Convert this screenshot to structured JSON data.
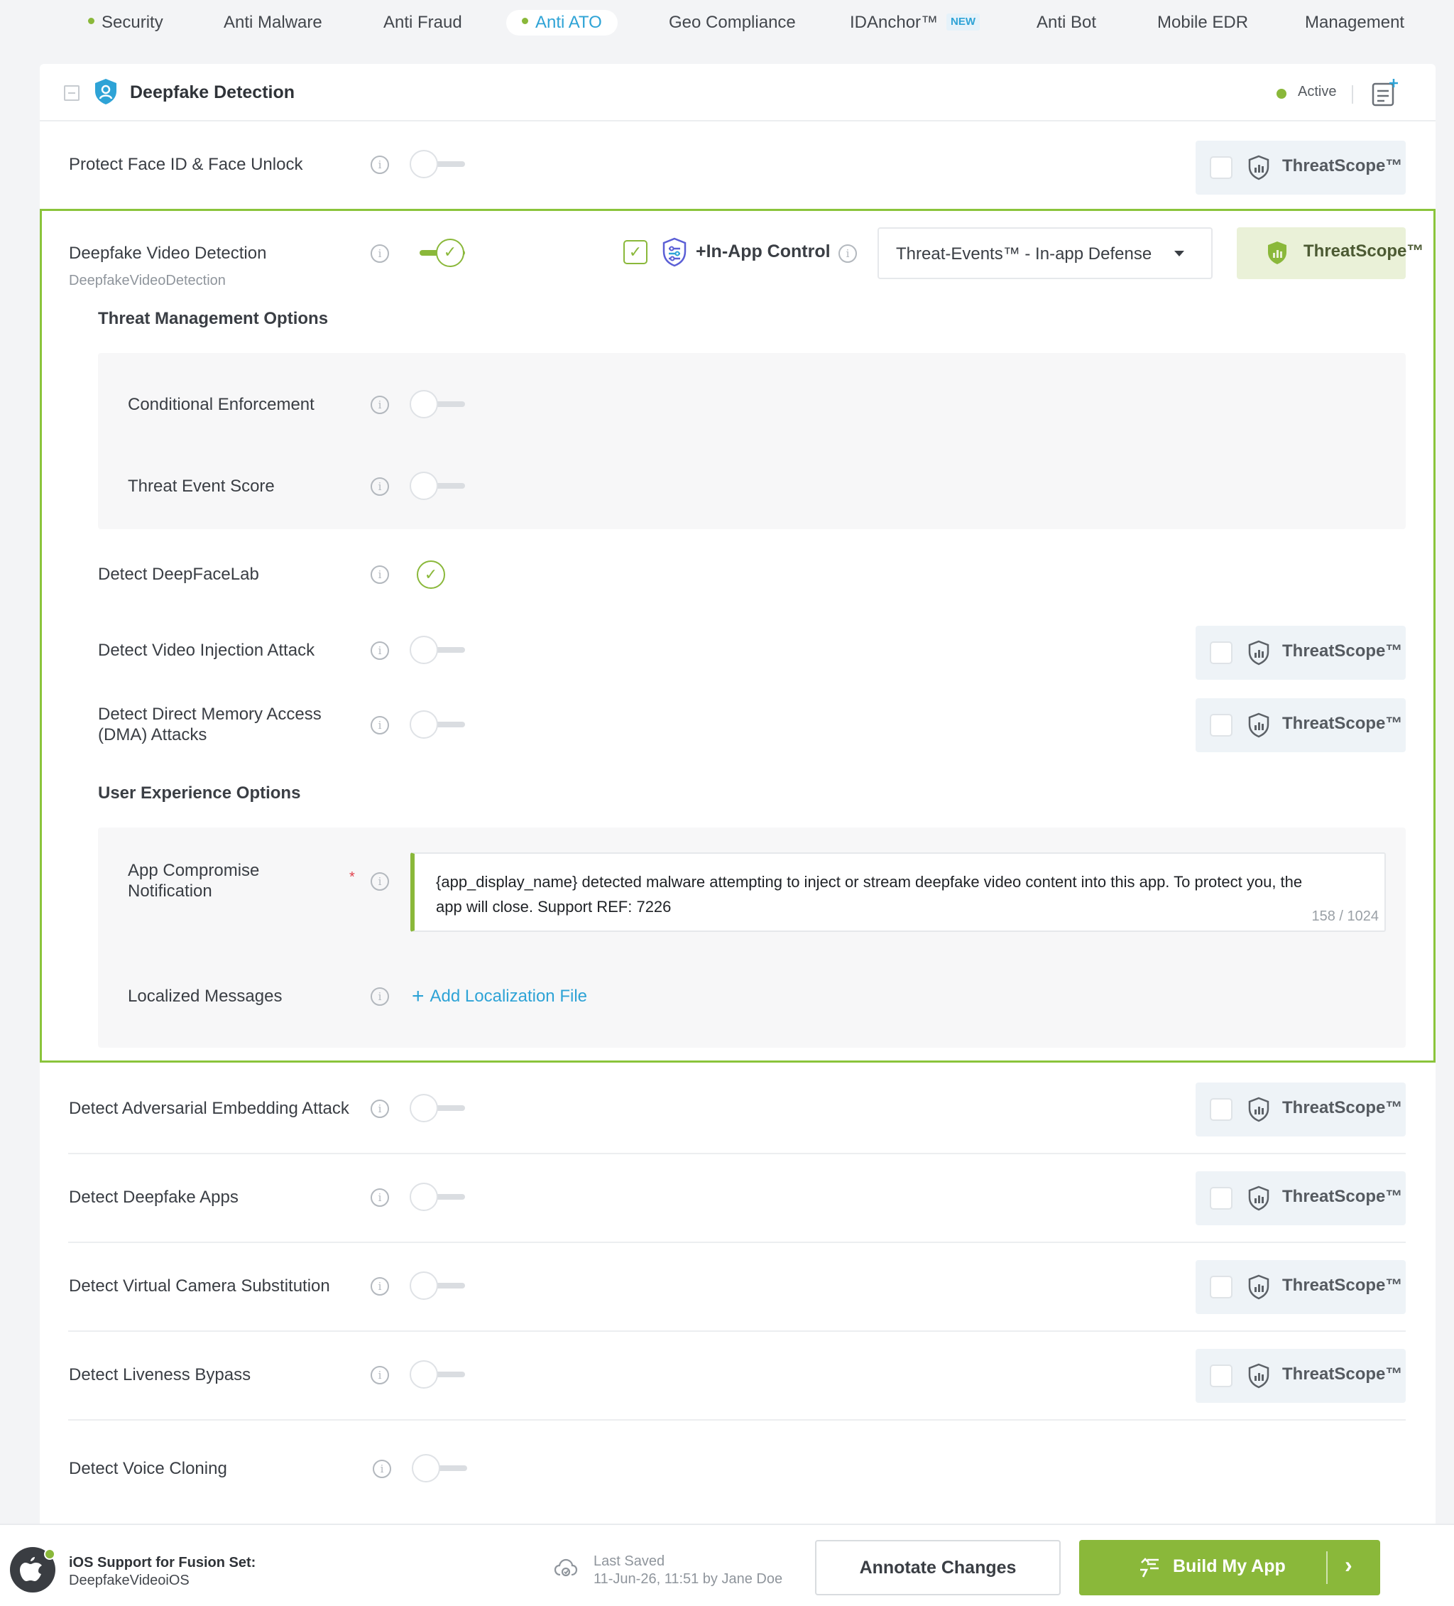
{
  "tabs": [
    {
      "label": "Security",
      "dot": true
    },
    {
      "label": "Anti Malware"
    },
    {
      "label": "Anti Fraud"
    },
    {
      "label": "Anti ATO",
      "dot": true,
      "active": true
    },
    {
      "label": "Geo Compliance"
    },
    {
      "label": "IDAnchor™",
      "badge": "NEW"
    },
    {
      "label": "Anti Bot"
    },
    {
      "label": "Mobile EDR"
    },
    {
      "label": "Management"
    }
  ],
  "section": {
    "title": "Deepfake Detection",
    "status": "Active"
  },
  "threatscope_label": "ThreatScope™",
  "rows": {
    "protect_face": {
      "label": "Protect Face ID & Face Unlock",
      "enabled": false
    },
    "video": {
      "label": "Deepfake Video Detection",
      "id": "DeepfakeVideoDetection",
      "enabled": true,
      "inapp_label": "+In-App Control",
      "inapp_checked": true,
      "select_value": "Threat-Events™ - In-app Defense"
    },
    "threat_mgmt_heading": "Threat Management Options",
    "conditional": {
      "label": "Conditional Enforcement",
      "enabled": false
    },
    "score": {
      "label": "Threat Event Score",
      "enabled": false
    },
    "deepfacelab": {
      "label": "Detect DeepFaceLab",
      "checked": true
    },
    "injection": {
      "label": "Detect Video Injection Attack",
      "enabled": false
    },
    "dma": {
      "label_line1": "Detect Direct Memory Access",
      "label_line2": "(DMA) Attacks",
      "enabled": false
    },
    "ux_heading": "User Experience Options",
    "notification": {
      "label_line1": "App Compromise",
      "label_line2": "Notification",
      "required_mark": "*",
      "message": "{app_display_name} detected malware attempting to inject or stream deepfake video content into this app. To protect you, the app will close. Support REF: 7226",
      "count": "158 / 1024"
    },
    "localized": {
      "label": "Localized Messages",
      "link": "Add Localization File"
    },
    "adversarial": {
      "label": "Detect Adversarial Embedding Attack",
      "enabled": false
    },
    "apps": {
      "label": "Detect Deepfake Apps",
      "enabled": false
    },
    "camera": {
      "label": "Detect Virtual Camera Substitution",
      "enabled": false
    },
    "liveness": {
      "label": "Detect Liveness Bypass",
      "enabled": false
    },
    "voice": {
      "label": "Detect Voice Cloning",
      "enabled": false
    }
  },
  "footer": {
    "platform_title": "iOS Support for Fusion Set:",
    "platform_name": "DeepfakeVideoiOS",
    "last_saved_label": "Last Saved",
    "last_saved_value": "11-Jun-26, 11:51 by Jane Doe",
    "annotate_label": "Annotate Changes",
    "build_label": "Build My App"
  },
  "colors": {
    "accent_green": "#8ab83a",
    "accent_blue": "#2ea3d6",
    "frame_green": "#8ac43b"
  }
}
